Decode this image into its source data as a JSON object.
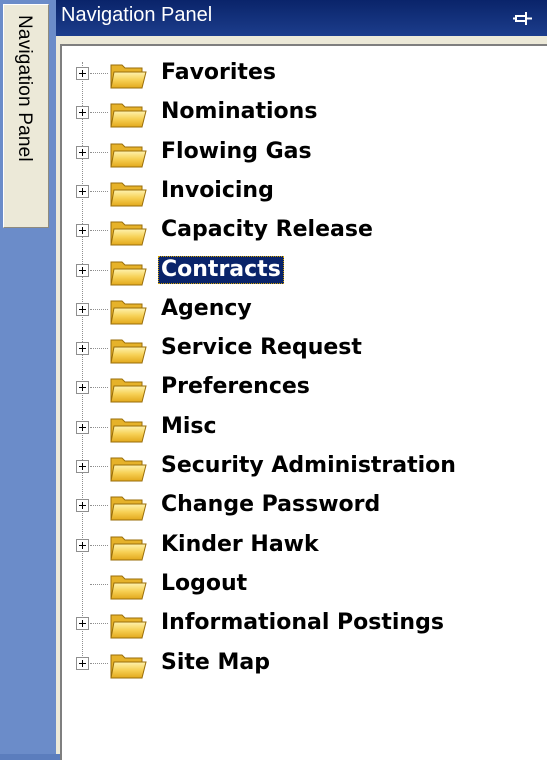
{
  "side_tab": {
    "label": "Navigation Panel"
  },
  "panel": {
    "title": "Navigation Panel",
    "pin_icon": "pin-icon"
  },
  "tree": {
    "items": [
      {
        "label": "Favorites",
        "expandable": true,
        "selected": false
      },
      {
        "label": "Nominations",
        "expandable": true,
        "selected": false
      },
      {
        "label": "Flowing Gas",
        "expandable": true,
        "selected": false
      },
      {
        "label": "Invoicing",
        "expandable": true,
        "selected": false
      },
      {
        "label": "Capacity Release",
        "expandable": true,
        "selected": false
      },
      {
        "label": "Contracts",
        "expandable": true,
        "selected": true
      },
      {
        "label": "Agency",
        "expandable": true,
        "selected": false
      },
      {
        "label": "Service Request",
        "expandable": true,
        "selected": false
      },
      {
        "label": "Preferences",
        "expandable": true,
        "selected": false
      },
      {
        "label": "Misc",
        "expandable": true,
        "selected": false
      },
      {
        "label": "Security Administration",
        "expandable": true,
        "selected": false
      },
      {
        "label": "Change Password",
        "expandable": true,
        "selected": false
      },
      {
        "label": "Kinder Hawk",
        "expandable": true,
        "selected": false
      },
      {
        "label": "Logout",
        "expandable": false,
        "selected": false
      },
      {
        "label": "Informational Postings",
        "expandable": true,
        "selected": false
      },
      {
        "label": "Site Map",
        "expandable": true,
        "selected": false
      }
    ],
    "folder_icon": "folder-icon",
    "expander_icon": "plus-expander-icon"
  },
  "colors": {
    "title_bar": "#0a246a",
    "selection": "#0a246a",
    "panel_bg": "#ece9d8",
    "folder": "#f5c842"
  }
}
